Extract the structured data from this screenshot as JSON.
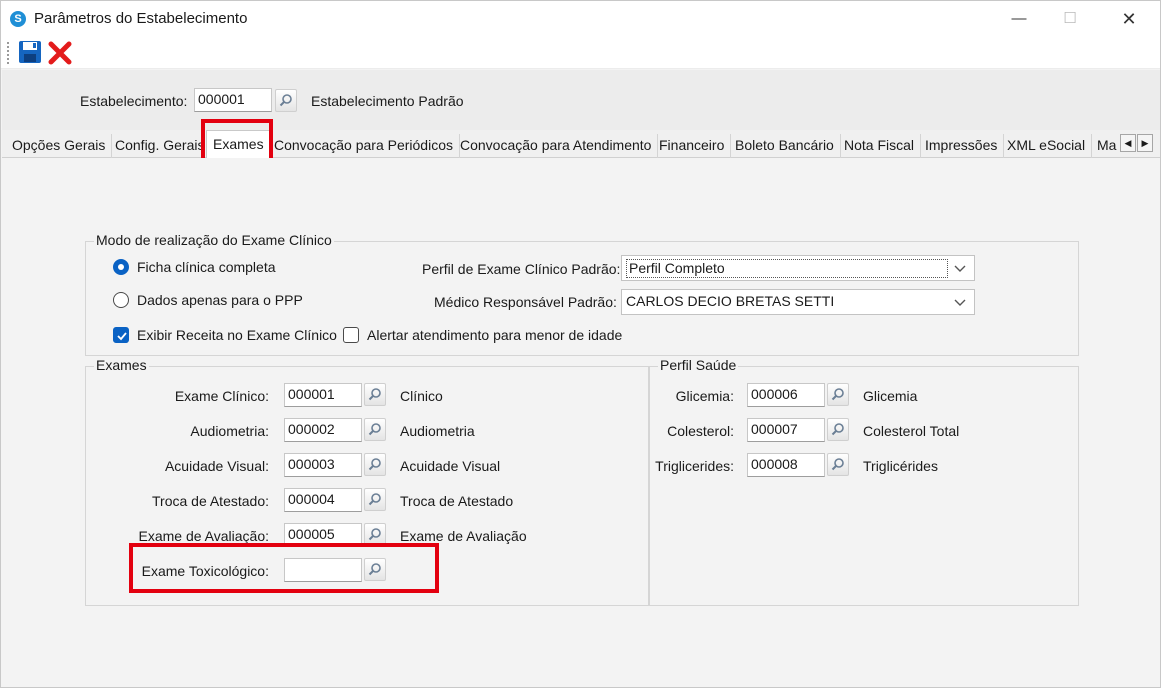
{
  "window": {
    "title": "Parâmetros do Estabelecimento",
    "app_icon": "app-logo-icon",
    "controls": {
      "minimize": "—",
      "maximize": "☐",
      "close": "✕"
    }
  },
  "toolbar": {
    "save_icon": "floppy-disk-icon",
    "cancel_icon": "red-x-icon"
  },
  "header": {
    "estabelecimento_label": "Estabelecimento:",
    "estabelecimento_value": "000001",
    "estabelecimento_name": "Estabelecimento Padrão"
  },
  "tabs": [
    {
      "label": "Opções Gerais"
    },
    {
      "label": "Config. Gerais"
    },
    {
      "label": "Exames",
      "active": true
    },
    {
      "label": "Convocação para Periódicos"
    },
    {
      "label": "Convocação para Atendimento"
    },
    {
      "label": "Financeiro"
    },
    {
      "label": "Boleto Bancário"
    },
    {
      "label": "Nota Fiscal"
    },
    {
      "label": "Impressões"
    },
    {
      "label": "XML eSocial"
    },
    {
      "label": "Ma"
    }
  ],
  "modo": {
    "title": "Modo de realização do Exame Clínico",
    "radio_ficha": "Ficha clínica completa",
    "radio_ficha_checked": true,
    "radio_ppp": "Dados apenas para o PPP",
    "radio_ppp_checked": false,
    "perfil_label": "Perfil de Exame Clínico Padrão:",
    "perfil_value": "Perfil Completo",
    "medico_label": "Médico Responsável Padrão:",
    "medico_value": "CARLOS DECIO BRETAS SETTI",
    "chk_receita": "Exibir Receita no Exame Clínico",
    "chk_receita_checked": true,
    "chk_alertar": "Alertar atendimento para menor de idade",
    "chk_alertar_checked": false
  },
  "exames": {
    "title": "Exames",
    "rows": [
      {
        "label": "Exame Clínico:",
        "code": "000001",
        "desc": "Clínico"
      },
      {
        "label": "Audiometria:",
        "code": "000002",
        "desc": "Audiometria"
      },
      {
        "label": "Acuidade Visual:",
        "code": "000003",
        "desc": "Acuidade Visual"
      },
      {
        "label": "Troca de Atestado:",
        "code": "000004",
        "desc": "Troca de Atestado"
      },
      {
        "label": "Exame de Avaliação:",
        "code": "000005",
        "desc": "Exame de Avaliação"
      },
      {
        "label": "Exame Toxicológico:",
        "code": "",
        "desc": ""
      }
    ]
  },
  "perfil_saude": {
    "title": "Perfil Saúde",
    "rows": [
      {
        "label": "Glicemia:",
        "code": "000006",
        "desc": "Glicemia"
      },
      {
        "label": "Colesterol:",
        "code": "000007",
        "desc": "Colesterol Total"
      },
      {
        "label": "Triglicerides:",
        "code": "000008",
        "desc": "Triglicérides"
      }
    ]
  },
  "colors": {
    "accent": "#0a62c4",
    "highlight": "#e3000f"
  }
}
